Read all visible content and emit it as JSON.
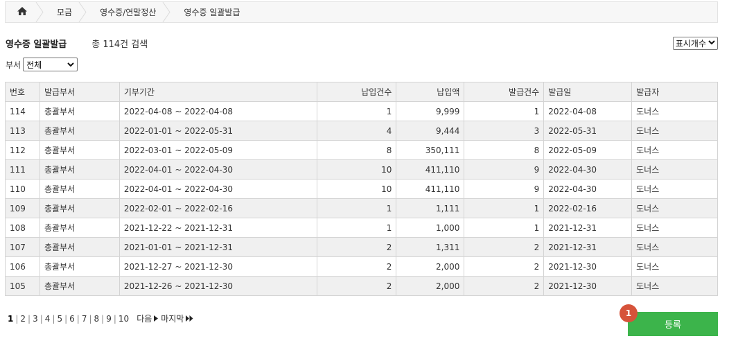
{
  "breadcrumb": {
    "home_icon": "home-icon",
    "items": [
      "모금",
      "영수증/연말정산",
      "영수증 일괄발급"
    ]
  },
  "header": {
    "title": "영수증 일괄발급",
    "count_text": "총 114건 검색",
    "display_select": "표시개수"
  },
  "filter": {
    "dept_label": "부서",
    "dept_value": "전체"
  },
  "table": {
    "columns": [
      "번호",
      "발급부서",
      "기부기간",
      "납입건수",
      "납입액",
      "발급건수",
      "발급일",
      "발급자"
    ],
    "rows": [
      [
        "114",
        "총괄부서",
        "2022-04-08 ~ 2022-04-08",
        "1",
        "9,999",
        "1",
        "2022-04-08",
        "도너스"
      ],
      [
        "113",
        "총괄부서",
        "2022-01-01 ~ 2022-05-31",
        "4",
        "9,444",
        "3",
        "2022-05-31",
        "도너스"
      ],
      [
        "112",
        "총괄부서",
        "2022-03-01 ~ 2022-05-09",
        "8",
        "350,111",
        "8",
        "2022-05-09",
        "도너스"
      ],
      [
        "111",
        "총괄부서",
        "2022-04-01 ~ 2022-04-30",
        "10",
        "411,110",
        "9",
        "2022-04-30",
        "도너스"
      ],
      [
        "110",
        "총괄부서",
        "2022-04-01 ~ 2022-04-30",
        "10",
        "411,110",
        "9",
        "2022-04-30",
        "도너스"
      ],
      [
        "109",
        "총괄부서",
        "2022-02-01 ~ 2022-02-16",
        "1",
        "1,111",
        "1",
        "2022-02-16",
        "도너스"
      ],
      [
        "108",
        "총괄부서",
        "2021-12-22 ~ 2021-12-31",
        "1",
        "1,000",
        "1",
        "2021-12-31",
        "도너스"
      ],
      [
        "107",
        "총괄부서",
        "2021-01-01 ~ 2021-12-31",
        "2",
        "1,311",
        "2",
        "2021-12-31",
        "도너스"
      ],
      [
        "106",
        "총괄부서",
        "2021-12-27 ~ 2021-12-30",
        "2",
        "2,000",
        "2",
        "2021-12-30",
        "도너스"
      ],
      [
        "105",
        "총괄부서",
        "2021-12-26 ~ 2021-12-30",
        "2",
        "2,000",
        "2",
        "2021-12-30",
        "도너스"
      ]
    ]
  },
  "pagination": {
    "pages": [
      "1",
      "2",
      "3",
      "4",
      "5",
      "6",
      "7",
      "8",
      "9",
      "10"
    ],
    "active": "1",
    "next_label": "다음",
    "last_label": "마지막"
  },
  "actions": {
    "register_label": "등록",
    "badge": "1"
  },
  "colors": {
    "register_button": "#3cb44b",
    "badge": "#d6533a",
    "header_bg": "#f1f1f1",
    "stripe_bg": "#f0f0f0"
  }
}
